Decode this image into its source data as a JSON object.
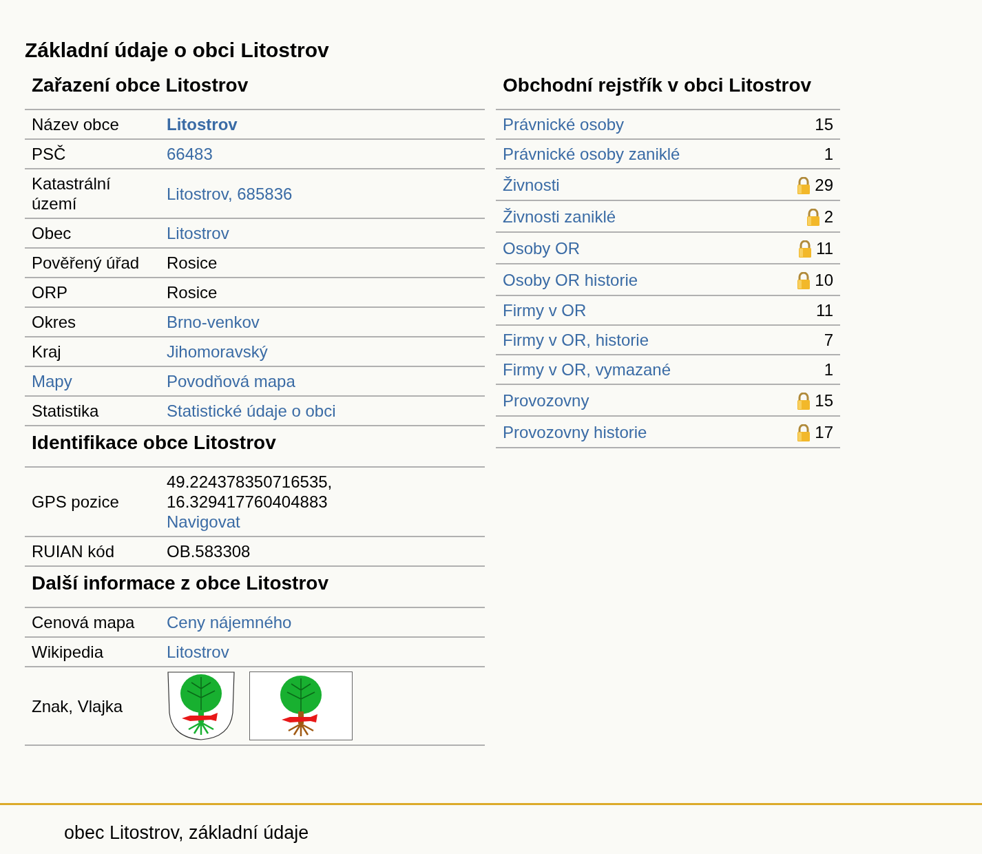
{
  "title": "Základní údaje o obci Litostrov",
  "left_sections": [
    {
      "heading": "Zařazení obce Litostrov",
      "rows": [
        {
          "label": {
            "text": "Název obce",
            "kind": "text"
          },
          "value": [
            {
              "text": "Litostrov",
              "kind": "strong-link"
            }
          ]
        },
        {
          "label": {
            "text": "PSČ",
            "kind": "text"
          },
          "value": [
            {
              "text": "66483",
              "kind": "link"
            }
          ]
        },
        {
          "label": {
            "text": "Katastrální území",
            "kind": "text"
          },
          "value": [
            {
              "text": "Litostrov, 685836",
              "kind": "link"
            }
          ]
        },
        {
          "label": {
            "text": "Obec",
            "kind": "text"
          },
          "value": [
            {
              "text": "Litostrov",
              "kind": "link"
            }
          ]
        },
        {
          "label": {
            "text": "Pověřený úřad",
            "kind": "text"
          },
          "value": [
            {
              "text": "Rosice",
              "kind": "text"
            }
          ]
        },
        {
          "label": {
            "text": "ORP",
            "kind": "text"
          },
          "value": [
            {
              "text": "Rosice",
              "kind": "text"
            }
          ]
        },
        {
          "label": {
            "text": "Okres",
            "kind": "text"
          },
          "value": [
            {
              "text": "Brno-venkov",
              "kind": "link"
            }
          ]
        },
        {
          "label": {
            "text": "Kraj",
            "kind": "text"
          },
          "value": [
            {
              "text": "Jihomoravský",
              "kind": "link"
            }
          ]
        },
        {
          "label": {
            "text": "Mapy",
            "kind": "link"
          },
          "value": [
            {
              "text": "Povodňová mapa",
              "kind": "link"
            }
          ]
        },
        {
          "label": {
            "text": "Statistika",
            "kind": "text"
          },
          "value": [
            {
              "text": "Statistické údaje o obci",
              "kind": "link"
            }
          ]
        }
      ]
    },
    {
      "heading": "Identifikace obce Litostrov",
      "rows": [
        {
          "label": {
            "text": "GPS pozice",
            "kind": "text"
          },
          "value": [
            {
              "text": "49.224378350716535,",
              "kind": "text"
            },
            {
              "text": "16.329417760404883",
              "kind": "text"
            },
            {
              "text": "Navigovat",
              "kind": "link"
            }
          ]
        },
        {
          "label": {
            "text": "RUIAN kód",
            "kind": "text"
          },
          "value": [
            {
              "text": "OB.583308",
              "kind": "text"
            }
          ]
        }
      ]
    },
    {
      "heading": "Další informace z obce Litostrov",
      "rows": [
        {
          "label": {
            "text": "Cenová mapa",
            "kind": "text"
          },
          "value": [
            {
              "text": "Ceny nájemného",
              "kind": "link"
            }
          ]
        },
        {
          "label": {
            "text": "Wikipedia",
            "kind": "text"
          },
          "value": [
            {
              "text": "Litostrov",
              "kind": "link"
            }
          ]
        },
        {
          "label": {
            "text": "Znak, Vlajka",
            "kind": "text"
          },
          "value": [
            {
              "kind": "emblems"
            }
          ]
        }
      ]
    }
  ],
  "register": {
    "heading": "Obchodní rejstřík v obci Litostrov",
    "rows": [
      {
        "label": "Právnické osoby",
        "count": "15",
        "locked": false
      },
      {
        "label": "Právnické osoby zaniklé",
        "count": "1",
        "locked": false
      },
      {
        "label": "Živnosti",
        "count": "29",
        "locked": true
      },
      {
        "label": "Živnosti zaniklé",
        "count": "2",
        "locked": true
      },
      {
        "label": "Osoby OR",
        "count": "11",
        "locked": true
      },
      {
        "label": "Osoby OR historie",
        "count": "10",
        "locked": true
      },
      {
        "label": "Firmy v OR",
        "count": "11",
        "locked": false
      },
      {
        "label": "Firmy v OR, historie",
        "count": "7",
        "locked": false
      },
      {
        "label": "Firmy v OR, vymazané",
        "count": "1",
        "locked": false
      },
      {
        "label": "Provozovny",
        "count": "15",
        "locked": true
      },
      {
        "label": "Provozovny historie",
        "count": "17",
        "locked": true
      }
    ]
  },
  "footer": "obec Litostrov, základní údaje"
}
